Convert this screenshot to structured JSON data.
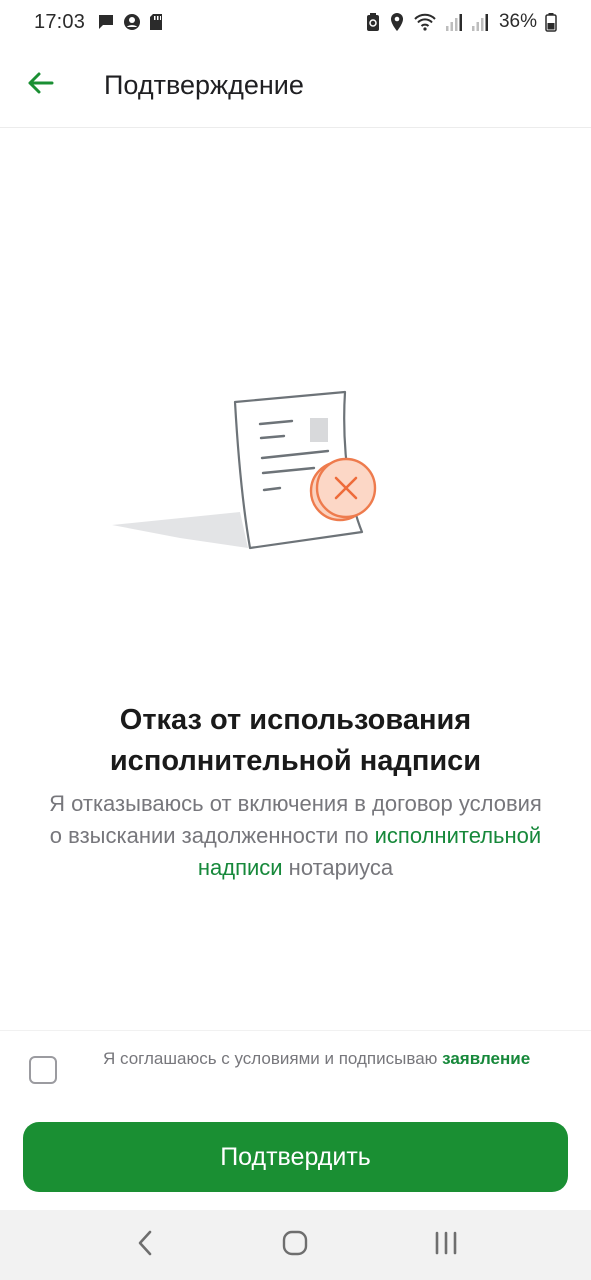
{
  "status_bar": {
    "time": "17:03",
    "battery": "36%",
    "icons": [
      "message-icon",
      "account-icon",
      "sd-card-icon",
      "recycle-icon",
      "location-icon",
      "wifi-icon",
      "signal-icon",
      "signal-icon",
      "battery-icon"
    ]
  },
  "app_bar": {
    "title": "Подтверждение",
    "back_icon": "arrow-left-icon"
  },
  "illustration": {
    "icon": "document-rejected-icon"
  },
  "content": {
    "heading": "Отказ от использования исполнительной надписи",
    "desc_part1": "Я отказываюсь от включения в договор условия о взыскании задолженности по ",
    "desc_link": "исполнительной надписи",
    "desc_part2": " нотариуса"
  },
  "agreement": {
    "text": "Я соглашаюсь с условиями и подписываю ",
    "link": "заявление",
    "checked": false
  },
  "actions": {
    "confirm_label": "Подтвердить"
  },
  "nav_bar": {
    "icons": [
      "back-nav-icon",
      "home-nav-icon",
      "recents-nav-icon"
    ]
  },
  "colors": {
    "accent": "#1a8f33",
    "link": "#16883a",
    "reject_orange": "#f07a4a",
    "reject_fill": "#fcd5c4"
  }
}
